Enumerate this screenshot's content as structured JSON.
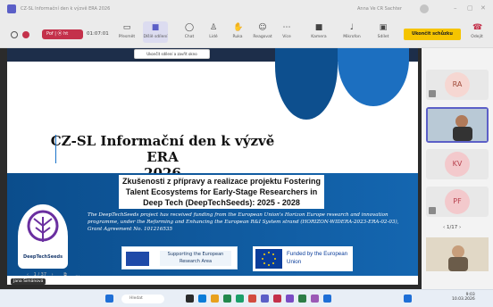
{
  "window": {
    "title": "CZ-SL Informační den k výzvě ERA 2026",
    "user": "Anna Ve CR Sachter"
  },
  "toolbar": {
    "rec_label": "Pof | ⦿ ht",
    "timer": "01:07:01",
    "buttons": [
      "Přesmět",
      "Dlšíě sdílení",
      "Chat",
      "Lidé",
      "Ruka",
      "Reagovat",
      "Více",
      "Kamera",
      "Mikrofon",
      "Sdílet"
    ],
    "leave": "Ukončit schůzku",
    "leave_small": "Odejít",
    "tooltip": "Ukončit sdílení a zavřít okno"
  },
  "slide": {
    "title_line1": "CZ-SL Informační den k výzvě ERA",
    "title_line2": "2026",
    "subtitle": "Zkušenosti z přípravy a realizace projektu Fostering Talent Ecosystems for Early-Stage Researchers in Deep Tech (DeepTechSeeds): 2025 - 2028",
    "funding_text": "The DeepTechSeeds project has received funding from the European Union's Horizon Europe research and innovation programme, under the Reforming and Enhancing the European R&I System strand (HORIZON-WIDERA-2023-ERA-02-03), Grant Agreement No. 101216535",
    "logo_text": "DeepTechSeeds",
    "supporting": "Supporting the European Research Area",
    "funded": "Funded by the European Union",
    "presenter": "Jana Šimánová"
  },
  "controls": {
    "page": "1 / 37",
    "more": "..."
  },
  "participants": [
    {
      "initials": "RA",
      "color": "#f6d7d2",
      "text": "#a04a3a"
    },
    {
      "initials": "",
      "color": "#cfe3f5",
      "text": "#333"
    },
    {
      "initials": "KV",
      "color": "#f3c9cc",
      "text": "#b7424e"
    },
    {
      "initials": "PF",
      "color": "#f3c9cc",
      "text": "#b7424e"
    }
  ],
  "pager": "1/17",
  "taskbar": {
    "search": "Hledat",
    "time": "9:03",
    "date": "10.03.2026"
  }
}
